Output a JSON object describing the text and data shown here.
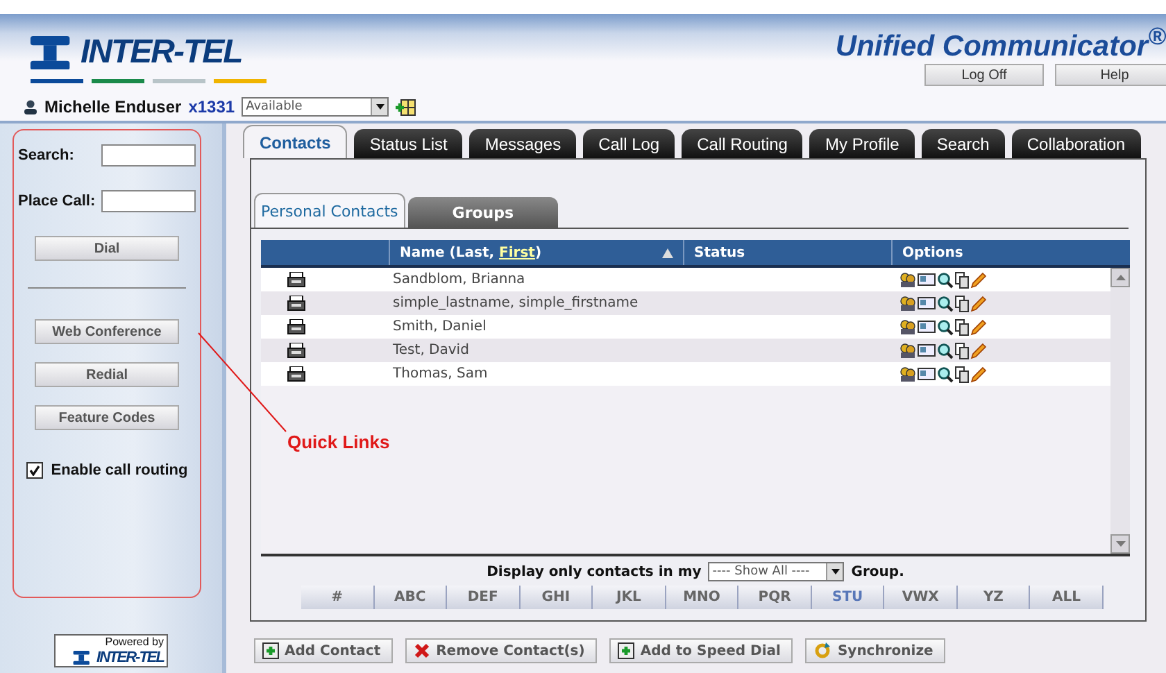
{
  "header": {
    "logo": "INTER-TEL",
    "product": "Unified Communicator",
    "product_mark": "®",
    "buttons": [
      {
        "label": "Log Off"
      },
      {
        "label": "Help"
      }
    ],
    "user": {
      "name": "Michelle Enduser",
      "extension": "x1331",
      "status": "Available"
    }
  },
  "sidebar": {
    "fields": [
      {
        "label": "Search:"
      },
      {
        "label": "Place Call:"
      }
    ],
    "dial": "Dial",
    "buttons": [
      "Web Conference",
      "Redial",
      "Feature Codes"
    ],
    "routing": {
      "label": "Enable call routing",
      "checked": true
    },
    "powered_by": "Powered by",
    "powered_logo": "INTER-TEL"
  },
  "annotation": "Quick Links",
  "tabs": [
    {
      "label": "Contacts",
      "selected": true
    },
    {
      "label": "Status List",
      "selected": false
    },
    {
      "label": "Messages",
      "selected": false
    },
    {
      "label": "Call Log",
      "selected": false
    },
    {
      "label": "Call Routing",
      "selected": false
    },
    {
      "label": "My Profile",
      "selected": false
    },
    {
      "label": "Search",
      "selected": false
    },
    {
      "label": "Collaboration",
      "selected": false
    }
  ],
  "subtabs": [
    {
      "label": "Personal Contacts",
      "selected": true
    },
    {
      "label": "Groups",
      "selected": false
    }
  ],
  "table": {
    "name_column": {
      "prefix": "Name (Last, ",
      "link": "First",
      "suffix": ")"
    },
    "columns": [
      "Status",
      "Options"
    ],
    "rows": [
      {
        "name": "Sandblom, Brianna"
      },
      {
        "name": "simple_lastname, simple_firstname"
      },
      {
        "name": "Smith, Daniel"
      },
      {
        "name": "Test, David"
      },
      {
        "name": "Thomas, Sam"
      }
    ]
  },
  "filter": {
    "before": "Display only contacts in my",
    "value": "---- Show All ----",
    "after": "Group."
  },
  "letters": [
    {
      "label": "#",
      "selected": false
    },
    {
      "label": "ABC",
      "selected": false
    },
    {
      "label": "DEF",
      "selected": false
    },
    {
      "label": "GHI",
      "selected": false
    },
    {
      "label": "JKL",
      "selected": false
    },
    {
      "label": "MNO",
      "selected": false
    },
    {
      "label": "PQR",
      "selected": false
    },
    {
      "label": "STU",
      "selected": true
    },
    {
      "label": "VWX",
      "selected": false
    },
    {
      "label": "YZ",
      "selected": false
    },
    {
      "label": "ALL",
      "selected": false
    }
  ],
  "actions": [
    {
      "label": "Add Contact",
      "kind": "add"
    },
    {
      "label": "Remove Contact(s)",
      "kind": "remove"
    },
    {
      "label": "Add to Speed Dial",
      "kind": "add"
    },
    {
      "label": "Synchronize",
      "kind": "sync"
    }
  ]
}
